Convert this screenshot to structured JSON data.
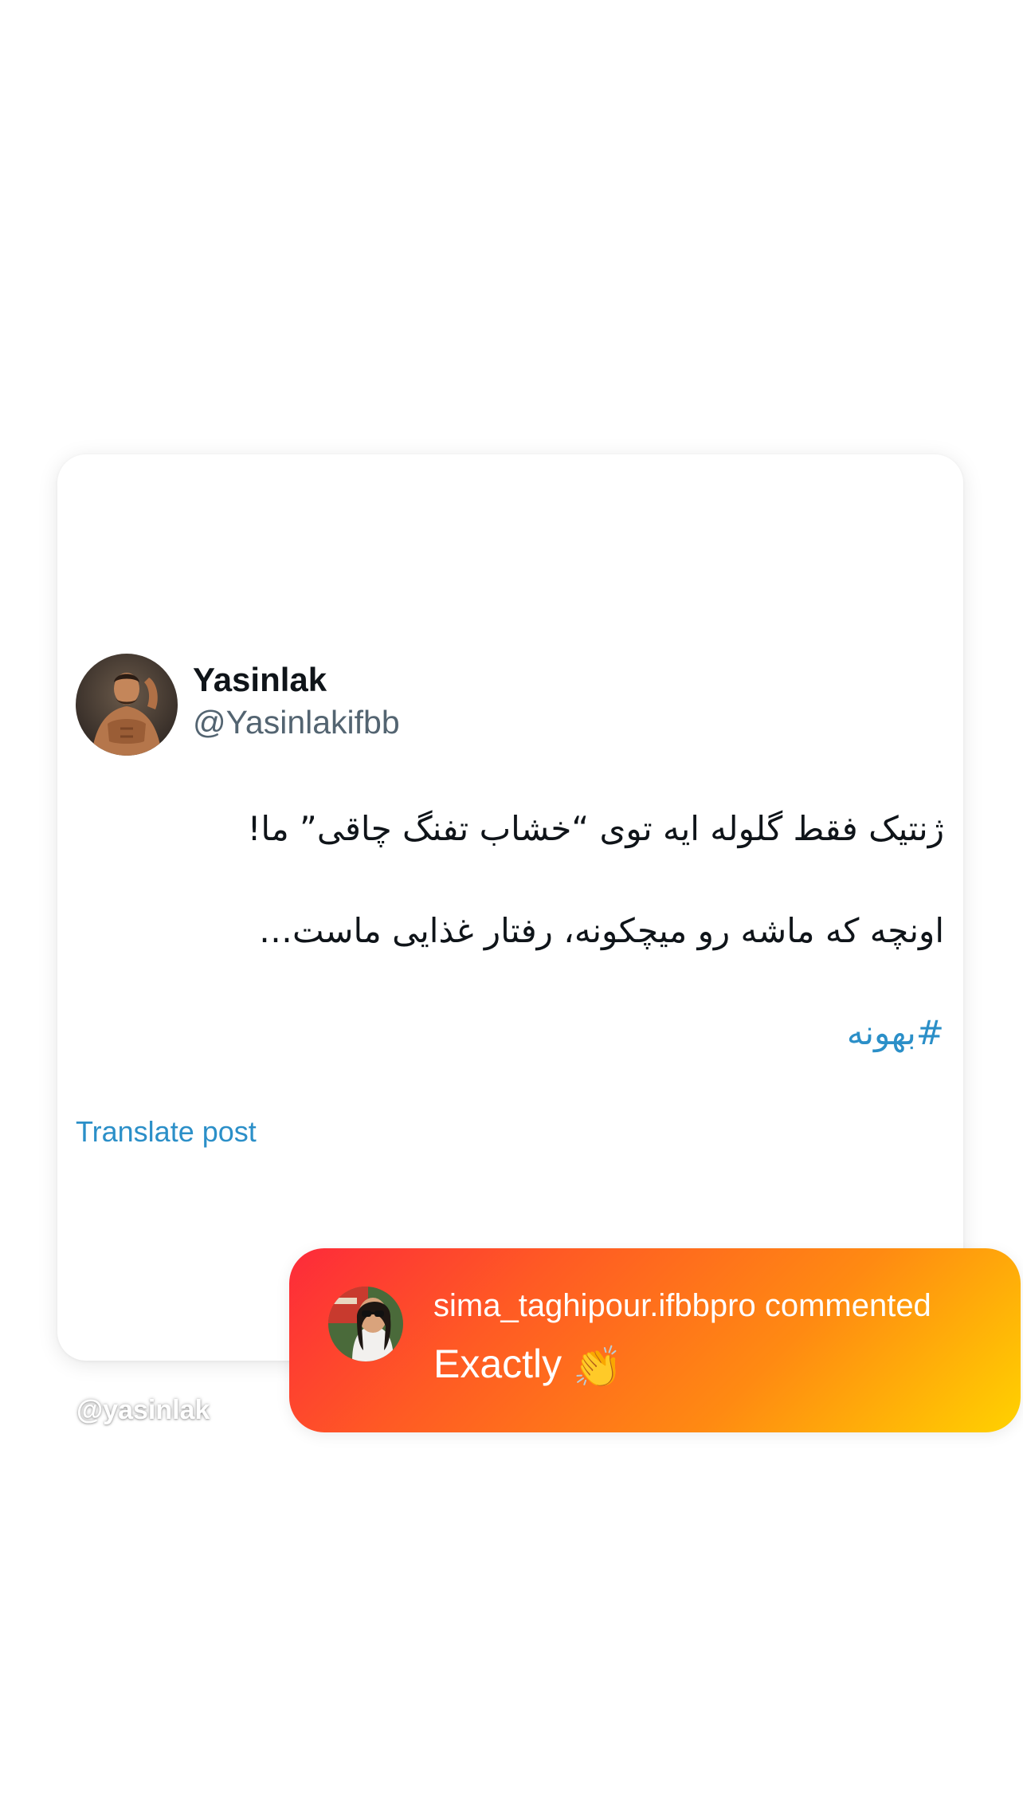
{
  "post": {
    "display_name": "Yasinlak",
    "handle": "@Yasinlakifbb",
    "avatar_icon": "profile-photo",
    "body_lines": [
      "ژنتیک فقط گلوله ایه توی “خشاب تفنگ چاقی” ما!",
      "اونچه که ماشه رو میچکونه، رفتار غذایی ماست…"
    ],
    "hashtag": "#بهونه",
    "translate_label": "Translate post"
  },
  "watermark": "@yasinlak",
  "notification": {
    "title": "sima_taghipour.ifbbpro commented",
    "body": "Exactly",
    "emoji": "👏",
    "avatar_icon": "commenter-photo",
    "colors": {
      "gradient_start": "#fd2a3a",
      "gradient_end": "#ffd200"
    }
  },
  "colors": {
    "link": "#2b8fc8",
    "handle": "#536471",
    "text": "#0f1419"
  }
}
